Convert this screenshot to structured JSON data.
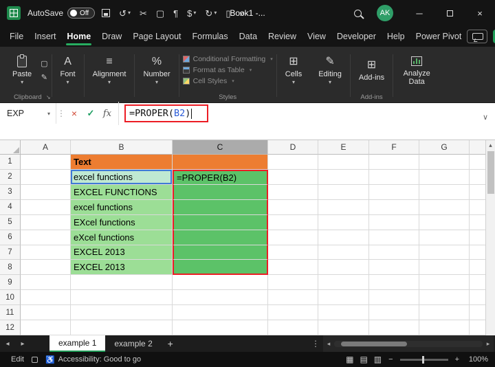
{
  "titlebar": {
    "autosave_label": "AutoSave",
    "autosave_state": "Off",
    "document_title": "Book1 -...",
    "avatar_initials": "AK"
  },
  "menubar": {
    "items": [
      "File",
      "Insert",
      "Home",
      "Draw",
      "Page Layout",
      "Formulas",
      "Data",
      "Review",
      "View",
      "Developer",
      "Help",
      "Power Pivot"
    ],
    "active": "Home"
  },
  "ribbon": {
    "paste_label": "Paste",
    "font_label": "Font",
    "alignment_label": "Alignment",
    "number_label": "Number",
    "styles_items": [
      "Conditional Formatting",
      "Format as Table",
      "Cell Styles"
    ],
    "cells_label": "Cells",
    "editing_label": "Editing",
    "addins_label": "Add-ins",
    "analyze_label": "Analyze Data",
    "group_clipboard": "Clipboard",
    "group_styles": "Styles",
    "group_addins": "Add-ins"
  },
  "formula_bar": {
    "name_box": "EXP",
    "formula_prefix": "=PROPER(",
    "formula_ref": "B2",
    "formula_suffix": ")"
  },
  "grid": {
    "columns": [
      "A",
      "B",
      "C",
      "D",
      "E",
      "F",
      "G"
    ],
    "active_column": "C",
    "rows": [
      {
        "n": 1,
        "cells": [
          [
            "",
            ""
          ],
          [
            "Text",
            "orange bold"
          ],
          [
            "",
            "orange"
          ],
          [
            "",
            ""
          ],
          [
            "",
            ""
          ],
          [
            "",
            ""
          ],
          [
            "",
            ""
          ]
        ]
      },
      {
        "n": 2,
        "cells": [
          [
            "",
            ""
          ],
          [
            "excel functions",
            "refcell"
          ],
          [
            "=PROPER(B2)",
            "cgreen rt"
          ],
          [
            "",
            ""
          ],
          [
            "",
            ""
          ],
          [
            "",
            ""
          ],
          [
            "",
            ""
          ]
        ]
      },
      {
        "n": 3,
        "cells": [
          [
            "",
            ""
          ],
          [
            "EXCEL FUNCTIONS",
            "lgreen"
          ],
          [
            "",
            "cgreen"
          ],
          [
            "",
            ""
          ],
          [
            "",
            ""
          ],
          [
            "",
            ""
          ],
          [
            "",
            ""
          ]
        ]
      },
      {
        "n": 4,
        "cells": [
          [
            "",
            ""
          ],
          [
            "excel functions",
            "lgreen"
          ],
          [
            "",
            "cgreen"
          ],
          [
            "",
            ""
          ],
          [
            "",
            ""
          ],
          [
            "",
            ""
          ],
          [
            "",
            ""
          ]
        ]
      },
      {
        "n": 5,
        "cells": [
          [
            "",
            ""
          ],
          [
            "EXcel functions",
            "lgreen"
          ],
          [
            "",
            "cgreen"
          ],
          [
            "",
            ""
          ],
          [
            "",
            ""
          ],
          [
            "",
            ""
          ],
          [
            "",
            ""
          ]
        ]
      },
      {
        "n": 6,
        "cells": [
          [
            "",
            ""
          ],
          [
            "eXcel functions",
            "lgreen"
          ],
          [
            "",
            "cgreen"
          ],
          [
            "",
            ""
          ],
          [
            "",
            ""
          ],
          [
            "",
            ""
          ],
          [
            "",
            ""
          ]
        ]
      },
      {
        "n": 7,
        "cells": [
          [
            "",
            ""
          ],
          [
            "EXCEL 2013",
            "lgreen"
          ],
          [
            "",
            "cgreen"
          ],
          [
            "",
            ""
          ],
          [
            "",
            ""
          ],
          [
            "",
            ""
          ],
          [
            "",
            ""
          ]
        ]
      },
      {
        "n": 8,
        "cells": [
          [
            "",
            ""
          ],
          [
            "EXCEL 2013",
            "lgreen"
          ],
          [
            "",
            "cgreen rb"
          ],
          [
            "",
            ""
          ],
          [
            "",
            ""
          ],
          [
            "",
            ""
          ],
          [
            "",
            ""
          ]
        ]
      },
      {
        "n": 9,
        "cells": [
          [
            "",
            ""
          ],
          [
            "",
            ""
          ],
          [
            "",
            ""
          ],
          [
            "",
            ""
          ],
          [
            "",
            ""
          ],
          [
            "",
            ""
          ],
          [
            "",
            ""
          ]
        ]
      },
      {
        "n": 10,
        "cells": [
          [
            "",
            ""
          ],
          [
            "",
            ""
          ],
          [
            "",
            ""
          ],
          [
            "",
            ""
          ],
          [
            "",
            ""
          ],
          [
            "",
            ""
          ],
          [
            "",
            ""
          ]
        ]
      },
      {
        "n": 11,
        "cells": [
          [
            "",
            ""
          ],
          [
            "",
            ""
          ],
          [
            "",
            ""
          ],
          [
            "",
            ""
          ],
          [
            "",
            ""
          ],
          [
            "",
            ""
          ],
          [
            "",
            ""
          ]
        ]
      },
      {
        "n": 12,
        "cells": [
          [
            "",
            ""
          ],
          [
            "",
            ""
          ],
          [
            "",
            ""
          ],
          [
            "",
            ""
          ],
          [
            "",
            ""
          ],
          [
            "",
            ""
          ],
          [
            "",
            ""
          ]
        ]
      }
    ]
  },
  "sheet_tabs": {
    "tabs": [
      {
        "label": "example 1",
        "active": true
      },
      {
        "label": "example 2",
        "active": false
      }
    ],
    "add_label": "+"
  },
  "status_bar": {
    "mode": "Edit",
    "accessibility": "Accessibility: Good to go",
    "zoom": "100%"
  },
  "colors": {
    "accent_green": "#217346",
    "fill_orange": "#ED7D31",
    "fill_light_green": "#9CDE96",
    "fill_green": "#5CC268",
    "annotation_red": "#EC1C24",
    "reference_blue": "#3F7AD6"
  },
  "glyphs": {
    "undo": "↺",
    "redo": "↻",
    "cut": "✂",
    "copy": "▢",
    "pilcrow": "¶",
    "dollar": "$",
    "doc": "▯",
    "more": "»",
    "caret": "▾",
    "dots": "⋮",
    "cancel": "×",
    "check": "✓",
    "fx": "fx",
    "chev": "∨",
    "nav_left": "◂",
    "nav_right": "▸",
    "up": "▴",
    "view_normal": "▦",
    "view_layout": "▤",
    "view_break": "▥",
    "minus": "−",
    "plus": "+",
    "share": "⇧",
    "min": "─",
    "close": "×",
    "font": "A",
    "align": "≡",
    "number": "%",
    "cells": "⊞",
    "editing": "✎",
    "addins": "⊞",
    "a11y": "♿",
    "launcher": "↘"
  }
}
